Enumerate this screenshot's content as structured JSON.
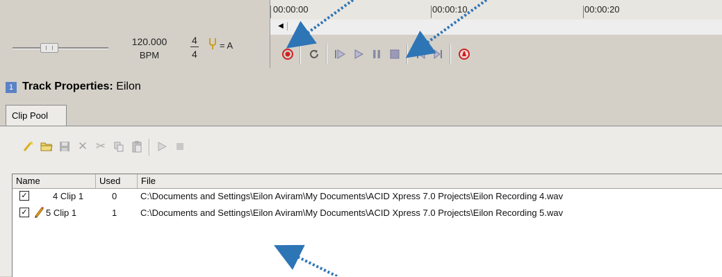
{
  "tempo": {
    "bpm_value": "120.000",
    "bpm_label": "BPM"
  },
  "time_signature": {
    "numerator": "4",
    "denominator": "4"
  },
  "key": {
    "label": "= A"
  },
  "timeline": {
    "markers": [
      "00:00:00",
      "00:00:10",
      "00:00:20"
    ]
  },
  "transport": {
    "buttons": [
      {
        "icon": "record-icon"
      },
      {
        "icon": "loop-icon"
      },
      {
        "icon": "play-from-start-icon"
      },
      {
        "icon": "play-icon"
      },
      {
        "icon": "pause-icon"
      },
      {
        "icon": "stop-icon"
      },
      {
        "icon": "go-to-start-icon"
      },
      {
        "icon": "go-to-end-icon"
      },
      {
        "icon": "metronome-icon"
      }
    ]
  },
  "track_properties": {
    "label": "Track Properties:",
    "track_name": "Eilon",
    "icon_text": "1"
  },
  "tabs": [
    {
      "label": "Clip Pool"
    }
  ],
  "clip_pool_toolbar": [
    "wand-icon",
    "open-folder-icon",
    "save-icon",
    "delete-icon",
    "cut-icon",
    "copy-icon",
    "paste-icon",
    "play-icon",
    "stop-icon"
  ],
  "clip_list": {
    "columns": [
      "Name",
      "Used",
      "File"
    ],
    "rows": [
      {
        "checked": true,
        "has_edit_icon": false,
        "name": "4 Clip 1",
        "used": "0",
        "file": "C:\\Documents and Settings\\Eilon Aviram\\My Documents\\ACID Xpress 7.0 Projects\\Eilon Recording 4.wav"
      },
      {
        "checked": true,
        "has_edit_icon": true,
        "name": "5 Clip 1",
        "used": "1",
        "file": "C:\\Documents and Settings\\Eilon Aviram\\My Documents\\ACID Xpress 7.0 Projects\\Eilon Recording 5.wav"
      }
    ]
  },
  "colors": {
    "annotation_arrow": "#2e75b6",
    "record_red": "#cc2222"
  }
}
